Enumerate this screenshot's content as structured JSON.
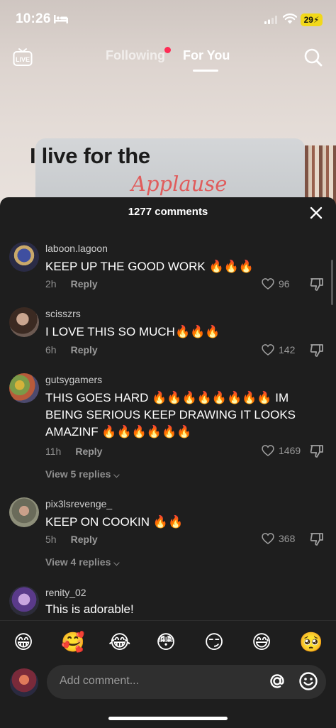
{
  "status_bar": {
    "time": "10:26",
    "battery": "29"
  },
  "top_nav": {
    "following_label": "Following",
    "for_you_label": "For You"
  },
  "video": {
    "caption_main": "I live for the",
    "caption_script": "Applause"
  },
  "comments_sheet": {
    "count_label": "1277 comments",
    "comments": [
      {
        "username": "laboon.lagoon",
        "text": "KEEP UP THE GOOD WORK 🔥🔥🔥",
        "time": "2h",
        "reply_label": "Reply",
        "likes": "96"
      },
      {
        "username": "scisszrs",
        "text": "I LOVE THIS SO MUCH🔥🔥🔥",
        "time": "6h",
        "reply_label": "Reply",
        "likes": "142"
      },
      {
        "username": "gutsygamers",
        "text": "THIS GOES HARD 🔥🔥🔥🔥🔥🔥🔥🔥 IM BEING SERIOUS KEEP DRAWING IT LOOKS AMAZINF 🔥🔥🔥🔥🔥🔥",
        "time": "11h",
        "reply_label": "Reply",
        "likes": "1469",
        "view_replies": "View 5 replies"
      },
      {
        "username": "pix3lsrevenge_",
        "text": "KEEP ON COOKIN 🔥🔥",
        "time": "5h",
        "reply_label": "Reply",
        "likes": "368",
        "view_replies": "View 4 replies"
      },
      {
        "username": "renity_02",
        "text": "This is adorable!"
      }
    ]
  },
  "emoji_bar": [
    "😁",
    "🥰",
    "😂",
    "😳",
    "😏",
    "😅",
    "🥺"
  ],
  "input": {
    "placeholder": "Add comment..."
  },
  "colors": {
    "accent": "#fe2c55",
    "sheet_bg": "#1e1e1e",
    "battery": "#f1d81a"
  }
}
